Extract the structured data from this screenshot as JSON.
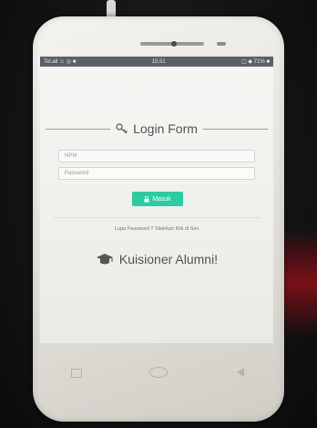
{
  "status_bar": {
    "left": "Tel.all ☺ ◎ ■",
    "time": "15.51",
    "right": "▢ ◆ 71% ■"
  },
  "form": {
    "title": "Login Form",
    "npm_placeholder": "NPM",
    "password_placeholder": "Password",
    "submit_label": "Masuk",
    "forgot_text": "Lupa Password ? Silahkan Klik di Sini"
  },
  "brand": {
    "name": "Kuisioner Alumni!"
  },
  "colors": {
    "accent": "#2ecba0",
    "status_bar": "#5b5f68"
  },
  "icons": {
    "title": "key-icon",
    "submit": "lock-icon",
    "brand": "graduation-cap-icon"
  }
}
